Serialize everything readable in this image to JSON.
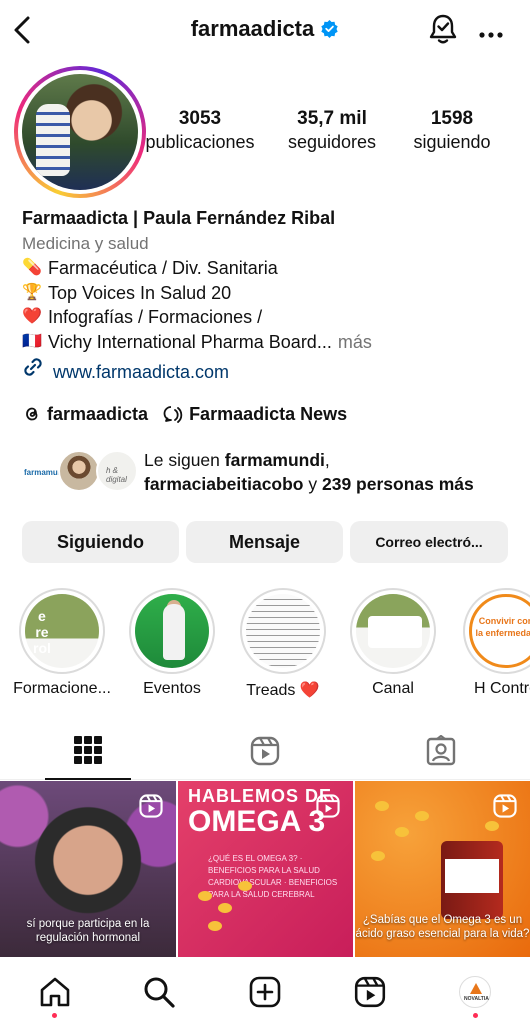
{
  "header": {
    "username": "farmaadicta",
    "verified_color": "#0095f6"
  },
  "stats": {
    "posts_count": "3053",
    "posts_label": "publicaciones",
    "followers_count": "35,7 mil",
    "followers_label": "seguidores",
    "following_count": "1598",
    "following_label": "siguiendo"
  },
  "bio": {
    "name": "Farmaadicta | Paula Fernández Ribal",
    "category": "Medicina y salud",
    "lines": [
      {
        "emoji": "💊",
        "text": "Farmacéutica / Div. Sanitaria"
      },
      {
        "emoji": "🏆",
        "text": "Top Voices In Salud 20"
      },
      {
        "emoji": "❤️",
        "text": "Infografías / Formaciones /"
      },
      {
        "emoji": "🇫🇷",
        "text": "Vichy International Pharma Board..."
      }
    ],
    "more": "más",
    "link": "www.farmaadicta.com"
  },
  "threads": {
    "handle": "farmaadicta",
    "channel": "Farmaadicta News"
  },
  "followed_by": {
    "prefix": "Le siguen ",
    "user1": "farmamundi",
    "sep": ",",
    "user2": "farmaciabeitiacobo",
    "mid": " y ",
    "others": "239 personas más",
    "avatar1_text": "farmamundi",
    "avatar3_text": "h & digital"
  },
  "actions": {
    "following": "Siguiendo",
    "message": "Mensaje",
    "email": "Correo electró..."
  },
  "highlights": [
    {
      "label": "Formacione...",
      "pic_text": "e\nre\nrol"
    },
    {
      "label": "Eventos"
    },
    {
      "label": "Treads ❤️"
    },
    {
      "label": "Canal"
    },
    {
      "label": "H Contro",
      "pic_text": "Convivir con\nla enfermedad"
    }
  ],
  "tabs": [
    "grid",
    "reels",
    "tagged"
  ],
  "posts": [
    {
      "caption": "sí porque participa en la regulación hormonal"
    },
    {
      "title_a": "HABLEMOS DE",
      "title_b": "OMEGA 3",
      "body": "¿QUÉ ES EL OMEGA 3? · BENEFICIOS PARA LA SALUD CARDIOVASCULAR · BENEFICIOS PARA LA SALUD CEREBRAL"
    },
    {
      "caption": "¿Sabías que el Omega 3 es un ácido graso esencial para la vida?"
    }
  ],
  "bottom_nav": [
    "home",
    "search",
    "create",
    "reels",
    "profile"
  ],
  "nav_avatar_text": "NOVALTIA",
  "colors": {
    "link": "#00376b",
    "muted": "#737373",
    "button_bg": "#efefef",
    "notification_dot": "#ff2d55"
  }
}
